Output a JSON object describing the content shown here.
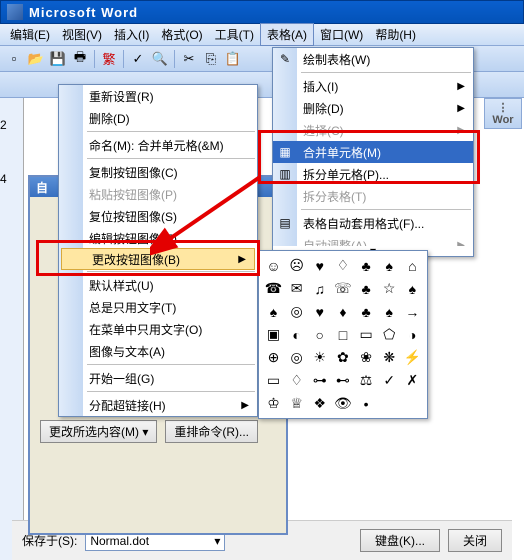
{
  "titlebar": {
    "text": "Microsoft Word"
  },
  "menubar": {
    "items": [
      "编辑(E)",
      "视图(V)",
      "插入(I)",
      "格式(O)",
      "工具(T)",
      "表格(A)",
      "窗口(W)",
      "帮助(H)"
    ],
    "active_index": 5
  },
  "context_menu": {
    "items": [
      {
        "label": "重新设置(R)",
        "enabled": true
      },
      {
        "label": "删除(D)",
        "enabled": true
      },
      {
        "label": "命名(M): 合并单元格(&M)",
        "enabled": true
      },
      {
        "label": "复制按钮图像(C)",
        "enabled": true
      },
      {
        "label": "粘贴按钮图像(P)",
        "enabled": false
      },
      {
        "label": "复位按钮图像(S)",
        "enabled": true
      },
      {
        "label": "编辑按钮图像(E)...",
        "enabled": true
      },
      {
        "label": "更改按钮图像(B)",
        "enabled": true,
        "submenu": true,
        "highlight": true
      },
      {
        "label": "默认样式(U)",
        "enabled": true
      },
      {
        "label": "总是只用文字(T)",
        "enabled": true
      },
      {
        "label": "在菜单中只用文字(O)",
        "enabled": true
      },
      {
        "label": "图像与文本(A)",
        "enabled": true
      },
      {
        "label": "开始一组(G)",
        "enabled": true
      },
      {
        "label": "分配超链接(H)",
        "enabled": true,
        "submenu": true
      }
    ]
  },
  "dropdown_menu": {
    "items": [
      {
        "label": "绘制表格(W)",
        "icon": "✎"
      },
      {
        "label": "插入(I)",
        "submenu": true
      },
      {
        "label": "删除(D)",
        "submenu": true
      },
      {
        "label": "选择(C)",
        "submenu": true,
        "disabled": true
      },
      {
        "label": "合并单元格(M)",
        "icon": "▦",
        "selected": true
      },
      {
        "label": "拆分单元格(P)...",
        "icon": "▥"
      },
      {
        "label": "拆分表格(T)",
        "disabled": true
      },
      {
        "label": "表格自动套用格式(F)...",
        "icon": "▤"
      },
      {
        "label": "自动调整(A)",
        "submenu": true,
        "disabled": true
      }
    ]
  },
  "icon_picker": {
    "icons": [
      "☺",
      "☹",
      "♥",
      "♢",
      "♣",
      "♠",
      "⌂",
      "☎",
      "✉",
      "♫",
      "☏",
      "♣",
      "☆",
      "♠",
      "♠",
      "◎",
      "♥",
      "♦",
      "♣",
      "♠",
      "→",
      "▣",
      "◐",
      "○",
      "□",
      "▭",
      "⬠",
      "◑",
      "⊕",
      "◎",
      "☀",
      "✿",
      "❀",
      "❋",
      "⚡",
      "▭",
      "♢",
      "⊶",
      "⊷",
      "⚖",
      "✓",
      "✗",
      "♔",
      "♕",
      "❖",
      "👁",
      "•"
    ]
  },
  "bottom_buttons": {
    "modify": "更改所选内容(M) ▾",
    "rearrange": "重排命令(R)..."
  },
  "dialog": {
    "save_in_label": "保存于(S):",
    "save_in_value": "Normal.dot",
    "keyboard": "键盘(K)...",
    "close": "关闭"
  },
  "customize": {
    "title": "自"
  },
  "side_panel": {
    "label": "Wor"
  },
  "ruler": {
    "marks": [
      "2",
      "4"
    ]
  }
}
